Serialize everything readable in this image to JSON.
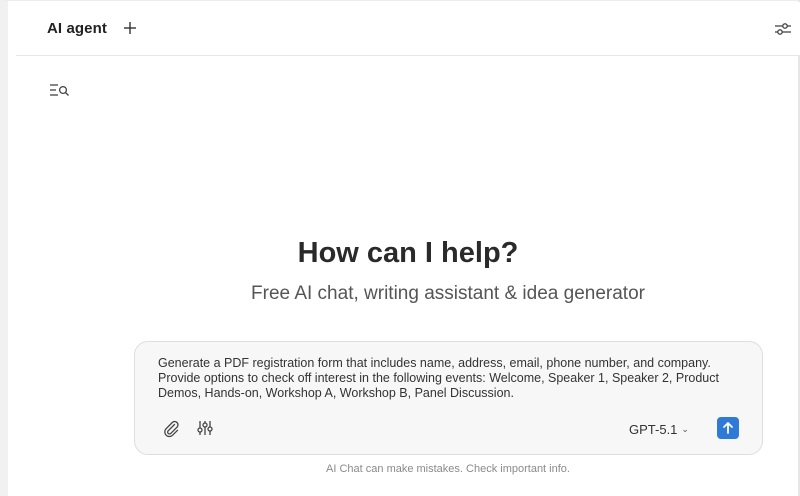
{
  "header": {
    "title": "AI agent",
    "new_tab_icon": "plus-icon",
    "settings_icon": "sliders-icon"
  },
  "sidebar": {
    "history_icon": "search-history-icon"
  },
  "hero": {
    "headline": "How can I help?",
    "subline": "Free AI chat, writing assistant & idea generator"
  },
  "composer": {
    "prompt": "Generate a PDF registration form that includes name, address, email, phone number, and company. Provide options to check off interest in the following events: Welcome, Speaker 1, Speaker 2, Product Demos, Hands-on, Workshop A, Workshop B, Panel Discussion.",
    "attach_icon": "paperclip-icon",
    "tools_icon": "tools-sliders-icon",
    "model": "GPT-5.1",
    "send_icon": "arrow-up-icon",
    "accent_color": "#2f7ad6"
  },
  "footer": {
    "disclaimer": "AI Chat can make mistakes. Check important info."
  }
}
